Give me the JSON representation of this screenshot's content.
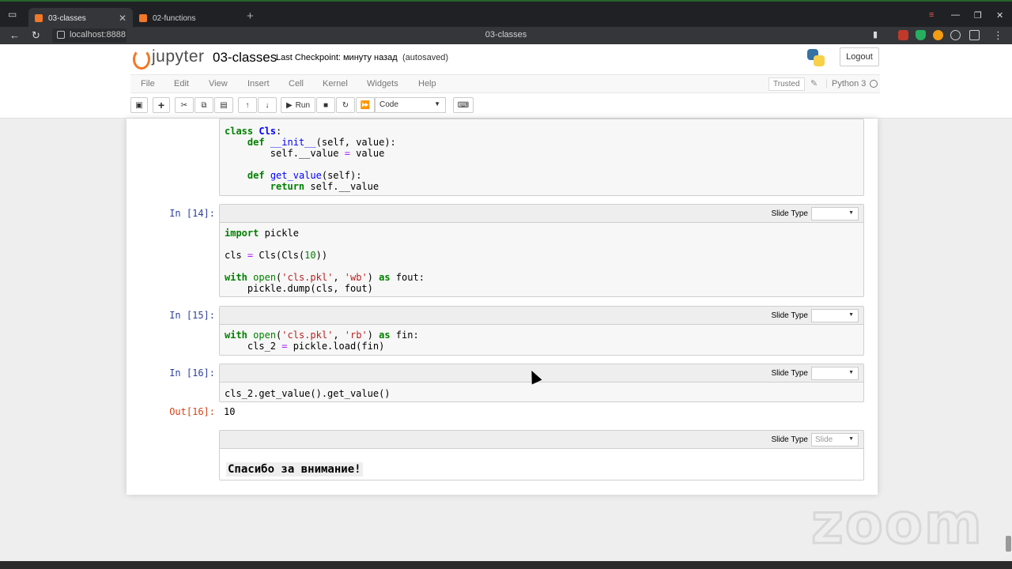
{
  "browser": {
    "tabs": [
      {
        "label": "03-classes",
        "active": true
      },
      {
        "label": "02-functions",
        "active": false
      }
    ],
    "url": "localhost:8888",
    "page_title": "03-classes"
  },
  "header": {
    "logo_text": "jupyter",
    "notebook_name": "03-classes",
    "checkpoint": "Last Checkpoint: минуту назад",
    "autosaved": "(autosaved)",
    "logout_label": "Logout"
  },
  "menu": {
    "items": [
      "File",
      "Edit",
      "View",
      "Insert",
      "Cell",
      "Kernel",
      "Widgets",
      "Help"
    ],
    "trusted": "Trusted",
    "kernel": "Python 3"
  },
  "toolbar": {
    "run_label": "Run",
    "cell_type": "Code"
  },
  "cells": {
    "slide_type_label": "Slide Type",
    "c14_prompt": "In [14]:",
    "c15_prompt": "In [15]:",
    "c16_prompt": "In [16]:",
    "c16_out_prompt": "Out[16]:",
    "c16_output": "10",
    "markdown_slide": "Slide",
    "markdown_text": "Спасибо за внимание!"
  },
  "overlay": {
    "watermark": "zoom"
  },
  "colors": {
    "prompt_in": "#303f9f",
    "prompt_out": "#d84315",
    "jupyter_orange": "#f37726"
  }
}
